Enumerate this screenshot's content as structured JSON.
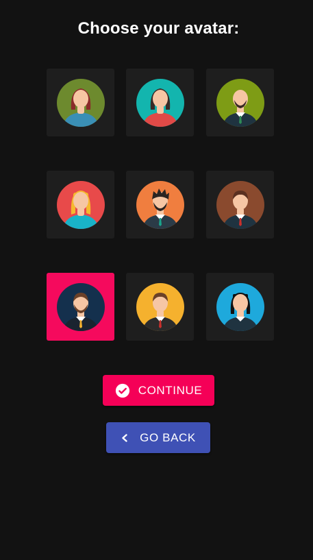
{
  "page": {
    "title": "Choose your avatar:"
  },
  "avatars": [
    {
      "id": "avatar-1",
      "selected": false,
      "bg": "#6d8a2e",
      "style": "woman-long-hair",
      "hair": "#8b2a2a",
      "skin": "#f6c6a4",
      "shirt": "#3a8fb5"
    },
    {
      "id": "avatar-2",
      "selected": false,
      "bg": "#13b5ae",
      "style": "woman-long-hair",
      "hair": "#3a2a26",
      "skin": "#f6c6a4",
      "shirt": "#e14a47"
    },
    {
      "id": "avatar-3",
      "selected": false,
      "bg": "#7e9c15",
      "style": "man-bald-beard",
      "hair": "#3a2a26",
      "skin": "#f6c6a4",
      "shirt": "#1f3340"
    },
    {
      "id": "avatar-4",
      "selected": false,
      "bg": "#e84a4a",
      "style": "woman-blonde",
      "hair": "#f5b92e",
      "skin": "#f6c6a4",
      "shirt": "#19b3c8"
    },
    {
      "id": "avatar-5",
      "selected": false,
      "bg": "#f07e3f",
      "style": "man-spiky-beard",
      "hair": "#2b2421",
      "skin": "#f6c6a4",
      "shirt": "#2b3b47"
    },
    {
      "id": "avatar-6",
      "selected": false,
      "bg": "#8a4a2e",
      "style": "man-short-hair",
      "hair": "#5a3020",
      "skin": "#f6c6a4",
      "shirt": "#1f3340"
    },
    {
      "id": "avatar-7",
      "selected": true,
      "bg": "#14304d",
      "style": "man-beard",
      "hair": "#6b4128",
      "skin": "#f6c6a4",
      "shirt": "#1a2430"
    },
    {
      "id": "avatar-8",
      "selected": false,
      "bg": "#f5b12e",
      "style": "man-short-hair",
      "hair": "#6b4128",
      "skin": "#f6c6a4",
      "shirt": "#2b2b2b"
    },
    {
      "id": "avatar-9",
      "selected": false,
      "bg": "#1ea9dc",
      "style": "woman-bob",
      "hair": "#111111",
      "skin": "#f6c6a4",
      "shirt": "#1f3340"
    }
  ],
  "buttons": {
    "continue_label": "CONTINUE",
    "continue_icon": "check-circle-icon",
    "continue_color": "#f50057",
    "back_label": "GO BACK",
    "back_icon": "chevron-left-icon",
    "back_color": "#3f51b5"
  },
  "colors": {
    "background": "#121212",
    "tile": "#1e1e1e",
    "selected_tile": "#f50a5d"
  }
}
